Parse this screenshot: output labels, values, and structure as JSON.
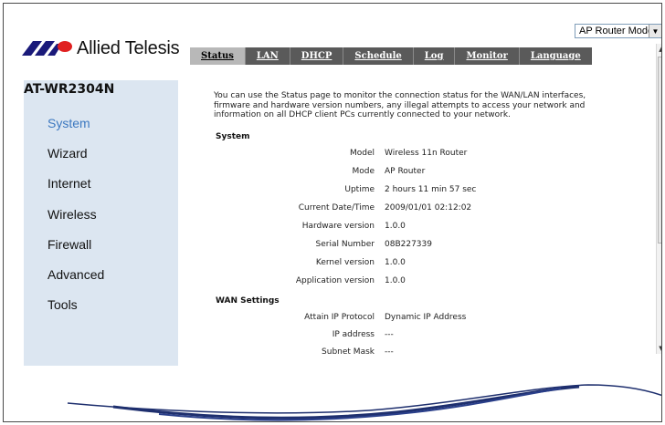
{
  "mode": {
    "value": "AP Router Mode",
    "arrow_icon": "chevron-down-icon"
  },
  "brand": {
    "name": "Allied Telesis",
    "accent": "#1a1a7a",
    "logo_red": "#e02020"
  },
  "tabs": [
    {
      "label": "Status",
      "active": true
    },
    {
      "label": "LAN"
    },
    {
      "label": "DHCP"
    },
    {
      "label": "Schedule"
    },
    {
      "label": "Log"
    },
    {
      "label": "Monitor"
    },
    {
      "label": "Language"
    }
  ],
  "sidebar": {
    "device": "AT-WR2304N",
    "items": [
      {
        "label": "System",
        "active": true
      },
      {
        "label": "Wizard"
      },
      {
        "label": "Internet"
      },
      {
        "label": "Wireless"
      },
      {
        "label": "Firewall"
      },
      {
        "label": "Advanced"
      },
      {
        "label": "Tools"
      }
    ]
  },
  "main": {
    "intro": [
      "You can use the Status page to monitor the connection status for the WAN/LAN interfaces,",
      "firmware and hardware version numbers, any illegal attempts to access your network and",
      "information on all DHCP client PCs currently connected to your network."
    ],
    "system": {
      "title": "System",
      "rows": [
        {
          "label": "Model",
          "value": "Wireless 11n Router"
        },
        {
          "label": "Mode",
          "value": "AP Router"
        },
        {
          "label": "Uptime",
          "value": "2 hours 11 min 57 sec"
        },
        {
          "label": "Current Date/Time",
          "value": "2009/01/01 02:12:02"
        },
        {
          "label": "Hardware version",
          "value": "1.0.0"
        },
        {
          "label": "Serial Number",
          "value": "08B227339"
        },
        {
          "label": "Kernel version",
          "value": "1.0.0"
        },
        {
          "label": "Application version",
          "value": "1.0.0"
        }
      ]
    },
    "wan": {
      "title": "WAN Settings",
      "rows": [
        {
          "label": "Attain IP Protocol",
          "value": "Dynamic IP Address"
        },
        {
          "label": "IP address",
          "value": "---"
        },
        {
          "label": "Subnet Mask",
          "value": "---"
        }
      ]
    }
  }
}
